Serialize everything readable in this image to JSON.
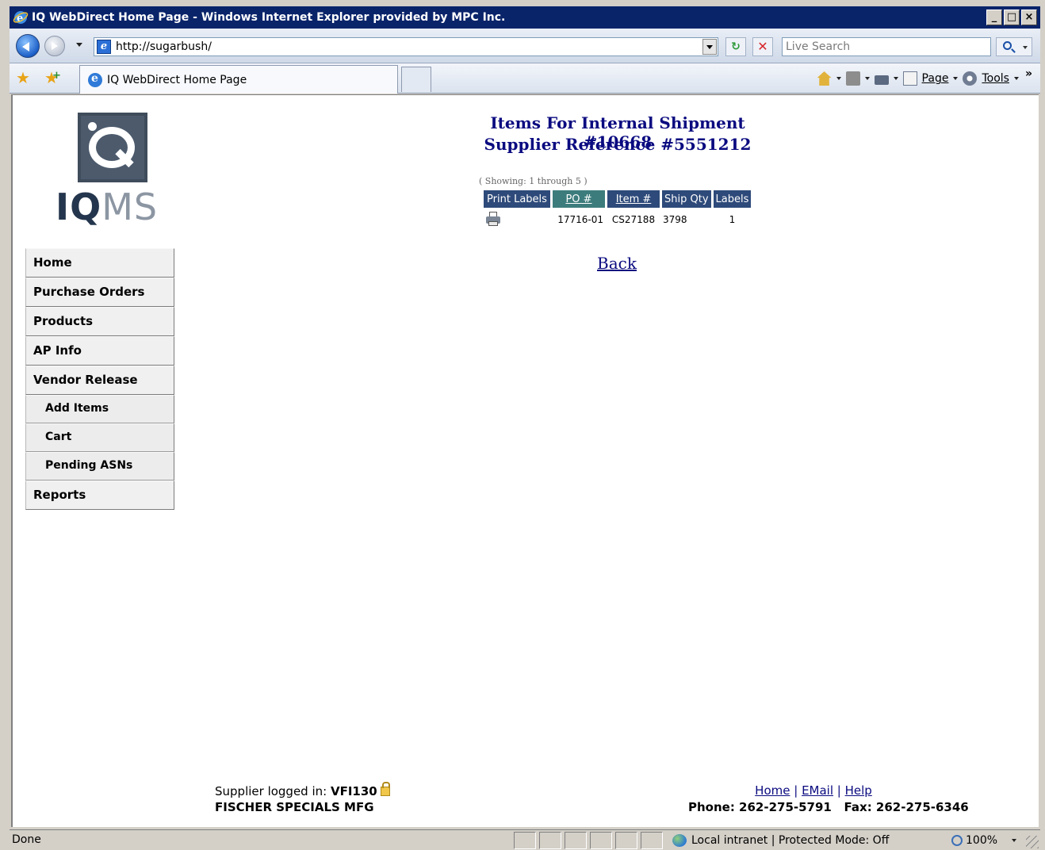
{
  "window": {
    "title": "IQ WebDirect Home Page - Windows Internet Explorer provided by MPC Inc.",
    "buttons": [
      "_",
      "□",
      "×"
    ]
  },
  "navbar": {
    "url": "http://sugarbush/",
    "search_placeholder": "Live Search"
  },
  "tabbar": {
    "tab_label": "IQ WebDirect Home Page",
    "page_label": "Page",
    "tools_label": "Tools",
    "more": "»"
  },
  "logo": {
    "text_iq": "IQ",
    "text_ms": "MS"
  },
  "menu": {
    "items": [
      {
        "label": "Home",
        "type": "main"
      },
      {
        "label": "Purchase Orders",
        "type": "main"
      },
      {
        "label": "Products",
        "type": "main"
      },
      {
        "label": "AP Info",
        "type": "main"
      },
      {
        "label": "Vendor Release",
        "type": "main"
      },
      {
        "label": "Add Items",
        "type": "sub"
      },
      {
        "label": "Cart",
        "type": "sub"
      },
      {
        "label": "Pending ASNs",
        "type": "sub"
      },
      {
        "label": "Reports",
        "type": "main"
      }
    ]
  },
  "main": {
    "title_line1": "Items For Internal Shipment #10668",
    "title_line2": "Supplier Reference #5551212",
    "showing": "( Showing: 1 through 5 )",
    "columns": [
      "Print Labels",
      "PO #",
      "Item #",
      "Ship Qty",
      "Labels"
    ],
    "rows": [
      {
        "po": "17716-01",
        "item": "CS27188",
        "ship_qty": "3798",
        "labels": "1"
      }
    ],
    "back_label": "Back"
  },
  "footer": {
    "logged_in_prefix": "Supplier logged in: ",
    "supplier_id": "VFI130",
    "company": "FISCHER SPECIALS MFG",
    "links": [
      "Home",
      "EMail",
      "Help"
    ],
    "separator": " | ",
    "phone": "Phone: 262-275-5791   Fax: 262-275-6346"
  },
  "statusbar": {
    "status": "Done",
    "zone": "Local intranet | Protected Mode: Off",
    "zoom": "100%"
  }
}
